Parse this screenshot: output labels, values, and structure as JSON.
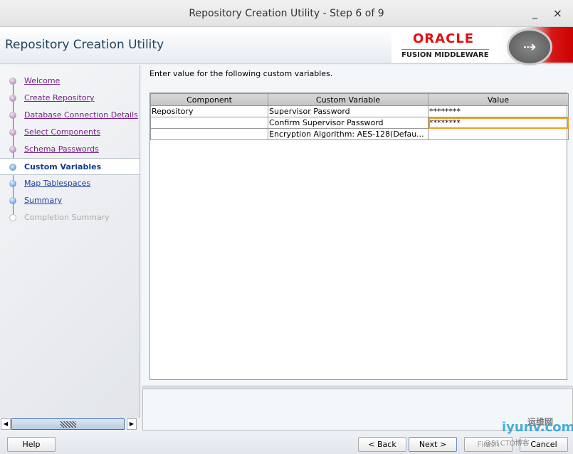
{
  "window": {
    "title": "Repository Creation Utility - Step 6 of 9",
    "minimize": "_",
    "close": "×"
  },
  "header": {
    "app_title": "Repository Creation Utility",
    "logo_brand": "ORACLE",
    "logo_sub": "FUSION MIDDLEWARE"
  },
  "nav": {
    "items": [
      {
        "label": "Welcome",
        "state": "done"
      },
      {
        "label": "Create Repository",
        "state": "done"
      },
      {
        "label": "Database Connection Details",
        "state": "done"
      },
      {
        "label": "Select Components",
        "state": "done"
      },
      {
        "label": "Schema Passwords",
        "state": "done"
      },
      {
        "label": "Custom Variables",
        "state": "current"
      },
      {
        "label": "Map Tablespaces",
        "state": "todo"
      },
      {
        "label": "Summary",
        "state": "todo"
      },
      {
        "label": "Completion Summary",
        "state": "pending"
      }
    ]
  },
  "main": {
    "instruction": "Enter value for the following custom variables.",
    "table": {
      "columns": [
        "Component",
        "Custom Variable",
        "Value"
      ],
      "rows": [
        [
          "Repository",
          "Supervisor Password",
          "********"
        ],
        [
          "",
          "Confirm Supervisor Password",
          "********"
        ],
        [
          "",
          "Encryption Algorithm: AES-128(Defau...",
          ""
        ]
      ]
    }
  },
  "footer": {
    "help": "Help",
    "back": "< Back",
    "next": "Next >",
    "finish": "Finish",
    "cancel": "Cancel"
  },
  "watermark": {
    "text": "运维网",
    "url": "iyunv.com",
    "prefix": "@51CTO博客"
  },
  "colors": {
    "visited": "#7a1f8a",
    "current": "#123a8a",
    "accent": "#e01010"
  }
}
